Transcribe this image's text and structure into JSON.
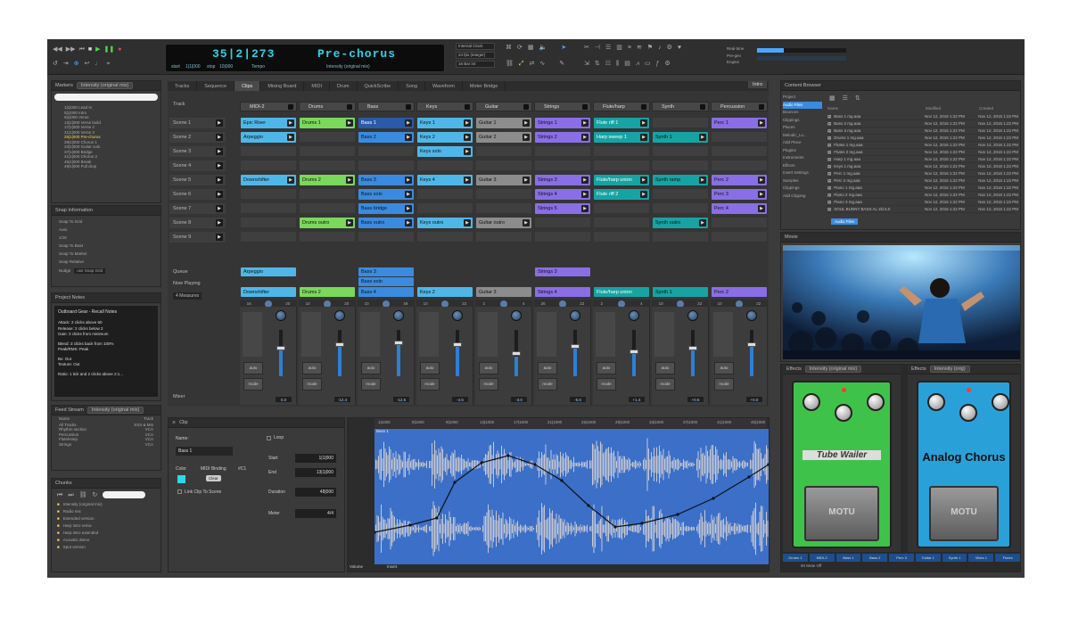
{
  "colors": {
    "accent": "#2bd3e8",
    "cyan": "#4fb7e8",
    "green": "#7ad85a",
    "blue": "#3a8be0",
    "purple": "#8a6ee6",
    "teal": "#17a3a3",
    "grey": "#8c8c8c",
    "selected": "#3a8be0"
  },
  "transport": {
    "counter": "35|2|273",
    "marker": "Pre-chorus",
    "start_label": "start",
    "start_val": "1|1|000",
    "stop_label": "stop",
    "stop_val": "10|000",
    "tempo_label": "Tempo",
    "mix_label": "Intensity (original mix)",
    "clock": "Internal Clock",
    "sync_label": "24 fps (integer)",
    "bar_label": "16 Bar int",
    "right_labels": [
      "Real-time",
      "Pre-gen",
      "Engine"
    ]
  },
  "tabs": [
    "Tracks",
    "Sequence",
    "Clips",
    "Mixing Board",
    "MIDI",
    "Drum",
    "QuickScribe",
    "Song",
    "Waveform",
    "Meter Bridge"
  ],
  "active_tab": "Clips",
  "tab_right": "Intro",
  "markers": {
    "title": "Markers",
    "mix": "Intensity (original mix)",
    "rows": [
      "1|1|000 Lead In",
      "5|1|000 Intro",
      "9|1|000 Verse",
      "13|1|000 Verse build",
      "17|1|000 Verse 2",
      "21|1|000 Verse 3",
      "25|1|000 Pre-chorus",
      "29|1|000 Chorus 1",
      "33|1|000 Guitar solo",
      "37|1|000 Bridge",
      "41|1|000 Chorus 3",
      "45|1|000 Break",
      "49|1|000 Full drop"
    ]
  },
  "snap": {
    "title": "Snap Information",
    "items": [
      "Snap To Grid",
      "Auto",
      "1/16",
      "Snap To Beat",
      "Snap To Marker",
      "Snap Relative"
    ],
    "nudge_label": "Nudge",
    "nudge_val": "use Snap Grid"
  },
  "notes": {
    "title": "Project Notes",
    "heading": "Outboard Gear - Recall Notes",
    "lines": [
      "Attack: 2 clicks above 60",
      "Release: 2 clicks below 2",
      "Gain: 3 clicks from minimum",
      "Blend: 3 clicks back from 100%",
      "Peak/RMS: Peak",
      "Bx: Out",
      "Texture: Out",
      "Ratio: 1 tick and 2 clicks above 2:1..."
    ]
  },
  "feeds": {
    "title": "Feed Stream",
    "mix": "Intensity (original mix)",
    "head": [
      "Name",
      "Track"
    ],
    "rows": [
      [
        "All Tracks",
        "SXS & MIx"
      ],
      [
        "Rhythm section",
        "VCA"
      ],
      [
        "Percussion",
        "VCA"
      ],
      [
        "Flute/Harp",
        "VCA"
      ],
      [
        "Strings",
        "VCA"
      ]
    ]
  },
  "chunks": {
    "title": "Chunks",
    "rows": [
      "Intensity (original mix)",
      "Radio mix",
      "Extended version",
      "Harp intro remix",
      "Harp intro extended",
      "Acoustic demo",
      "Spot version"
    ]
  },
  "tracks": [
    {
      "name": "MIDI-2",
      "color": "cyan"
    },
    {
      "name": "Drums",
      "color": "green"
    },
    {
      "name": "Bass",
      "color": "blue"
    },
    {
      "name": "Keys",
      "color": "cyan"
    },
    {
      "name": "Guitar",
      "color": "grey"
    },
    {
      "name": "Strings",
      "color": "purple"
    },
    {
      "name": "Flute/harp",
      "color": "teal"
    },
    {
      "name": "Synth",
      "color": "teal"
    },
    {
      "name": "Percussion",
      "color": "purple"
    }
  ],
  "scenes": [
    "Scene 1",
    "Scene 2",
    "Scene 3",
    "Scene 4",
    "Scene 5",
    "Scene 6",
    "Scene 7",
    "Scene 8",
    "Scene 9"
  ],
  "track_label": "Track",
  "queue": {
    "queue": "Queue",
    "now_playing": "Now Playing",
    "measures": "4 Measures"
  },
  "clips": [
    [
      [
        0,
        "Epic Riser"
      ],
      [
        1,
        "Arpeggio"
      ],
      [
        4,
        "Downshifter"
      ]
    ],
    [
      [
        0,
        "Drums 1"
      ],
      [
        4,
        "Drums 2"
      ],
      [
        7,
        "Drums outro"
      ]
    ],
    [
      [
        0,
        "Bass 1"
      ],
      [
        1,
        "Bass 2"
      ],
      [
        4,
        "Bass 3"
      ],
      [
        5,
        "Bass solo"
      ],
      [
        6,
        "Bass bridge"
      ],
      [
        7,
        "Bass outro"
      ]
    ],
    [
      [
        0,
        "Keys 1"
      ],
      [
        1,
        "Keys 2"
      ],
      [
        2,
        "Keys solo"
      ],
      [
        4,
        "Keys 4"
      ],
      [
        7,
        "Keys outro"
      ]
    ],
    [
      [
        0,
        "Guitar 1"
      ],
      [
        1,
        "Guitar 2"
      ],
      [
        4,
        "Guitar 3"
      ],
      [
        7,
        "Guitar outro"
      ]
    ],
    [
      [
        0,
        "Strings 1"
      ],
      [
        1,
        "Strings 2"
      ],
      [
        4,
        "Strings 3"
      ],
      [
        5,
        "Strings 4"
      ],
      [
        6,
        "Strings 5"
      ]
    ],
    [
      [
        0,
        "Flute riff 1"
      ],
      [
        1,
        "Harp sweep 1"
      ],
      [
        4,
        "Flute/harp union"
      ],
      [
        5,
        "Flute riff 2"
      ]
    ],
    [
      [
        1,
        "Synth 1"
      ],
      [
        4,
        "Synth ramp"
      ],
      [
        7,
        "Synth outro"
      ]
    ],
    [
      [
        0,
        "Perc 1"
      ],
      [
        4,
        "Perc 2"
      ],
      [
        5,
        "Perc 3"
      ],
      [
        6,
        "Perc 4"
      ]
    ]
  ],
  "queue_clips": [
    [
      [
        "Arpeggio"
      ],
      [
        "Downshifter"
      ]
    ],
    [
      [],
      [
        "Drums 2"
      ]
    ],
    [
      [
        "Bass 3",
        "Bass solo"
      ],
      [
        "Bass 4"
      ]
    ],
    [
      [],
      [
        "Keys 2"
      ]
    ],
    [
      [],
      [
        "Guitar 3"
      ]
    ],
    [
      [
        "Strings 3"
      ],
      [
        "Strings 4"
      ]
    ],
    [
      [],
      [
        "Flute/harp union"
      ]
    ],
    [
      [],
      [
        "Synth 1"
      ]
    ],
    [
      [],
      [
        "Perc 2"
      ]
    ]
  ],
  "mix_row": [
    [
      "16",
      "20"
    ],
    [
      "10",
      "20"
    ],
    [
      "10",
      "48"
    ],
    [
      "10",
      "22"
    ],
    [
      "2",
      "4"
    ],
    [
      "26",
      "22"
    ],
    [
      "2",
      "4"
    ],
    [
      "10",
      "22"
    ],
    [
      "10",
      "22"
    ]
  ],
  "mixer_vols": [
    "0.0",
    "-12.4",
    "-12.6",
    "-4.6",
    "-3.0",
    "-5.6",
    "+1.4",
    "+0.6",
    "+0.0"
  ],
  "mixer_label": "Mixer",
  "clip_panel": {
    "title": "Clip",
    "name_label": "Name:",
    "name": "Bass 1",
    "color_label": "Color",
    "midi_label": "MIDI Binding",
    "midi_val": "#C1",
    "clear": "Clear",
    "link": "Link Clip To Scene",
    "loop": "Loop",
    "start_label": "Start",
    "start": "1|1|000",
    "end_label": "End",
    "end": "13|1|000",
    "dur_label": "Duration",
    "dur": "48|000",
    "meter_label": "Meter",
    "meter": "4/4"
  },
  "waveform": {
    "ruler": [
      "1|1000",
      "5|1000",
      "9|1000",
      "13|1000",
      "17|1000",
      "21|1000",
      "25|1000",
      "29|1000",
      "33|1000",
      "37|1000",
      "41|1000",
      "45|1000"
    ],
    "clip_name": "Bass 1",
    "footer": [
      "Volume",
      "Insert"
    ]
  },
  "browser": {
    "title": "Content Browser",
    "tree": [
      "Project",
      "Audio Files",
      "Bounces",
      "Clippings",
      "Places",
      "Melodic_Lo...",
      "Add Place",
      "Plugins",
      "Instruments",
      "Effects",
      "Insert Settings",
      "Samples",
      "Clippings",
      "Add Clipping"
    ],
    "head": [
      "Name",
      "Modified",
      "Created"
    ],
    "files": [
      "Bass 1 mg.aaa",
      "Bass 2 mg.aaa",
      "Bass 3 mg.aaa",
      "Drums 1 mg.aaa",
      "Flutes 1 mg.aaa",
      "Flutes 2 mg.aaa",
      "Harp 1 mg.aaa",
      "Keys 1 mg.aaa",
      "Perc 1 mg.aaa",
      "Perc 2 mg.aaa",
      "Piano 1 mg.aaa",
      "Piano 2 mg.aaa",
      "Piano 3 mg.aaa",
      "SOUL BUNNY BASS AL 2kl.5.0"
    ],
    "dates": [
      "Nov 12, 2016 1:22 PM",
      "Nov 12, 2016 1:22 PM",
      "Nov 12, 2016 1:22 PM",
      "Nov 12, 2016 1:22 PM",
      "Nov 12, 2016 1:22 PM",
      "Nov 12, 2016 1:22 PM",
      "Nov 12, 2016 1:22 PM",
      "Nov 12, 2016 1:22 PM",
      "Nov 12, 2016 1:22 PM",
      "Nov 12, 2016 1:22 PM",
      "Nov 12, 2016 1:22 PM",
      "Nov 12, 2016 1:22 PM",
      "Nov 12, 2016 1:22 PM",
      "Nov 12, 2016 1:22 PM"
    ],
    "footer": "Audio Files"
  },
  "movie": {
    "title": "Movie"
  },
  "effects": [
    {
      "title": "Effects",
      "mix": "Intensity (original mix)",
      "name": "Tube Wailer",
      "brand": "MOTU",
      "color": "#3fc24a"
    },
    {
      "title": "Effects",
      "mix": "Intensity (orig)",
      "name": "Analog Chorus",
      "brand": "MOTU",
      "color": "#2aa0d8"
    }
  ],
  "bottom_tracks": [
    "Drums 1",
    "MIDI-2",
    "Bass 1",
    "Bass 2",
    "Perc 3",
    "Guitar 1",
    "Synth 1",
    "Vibes 1",
    "Flutes"
  ],
  "status": "50 Mute Off"
}
